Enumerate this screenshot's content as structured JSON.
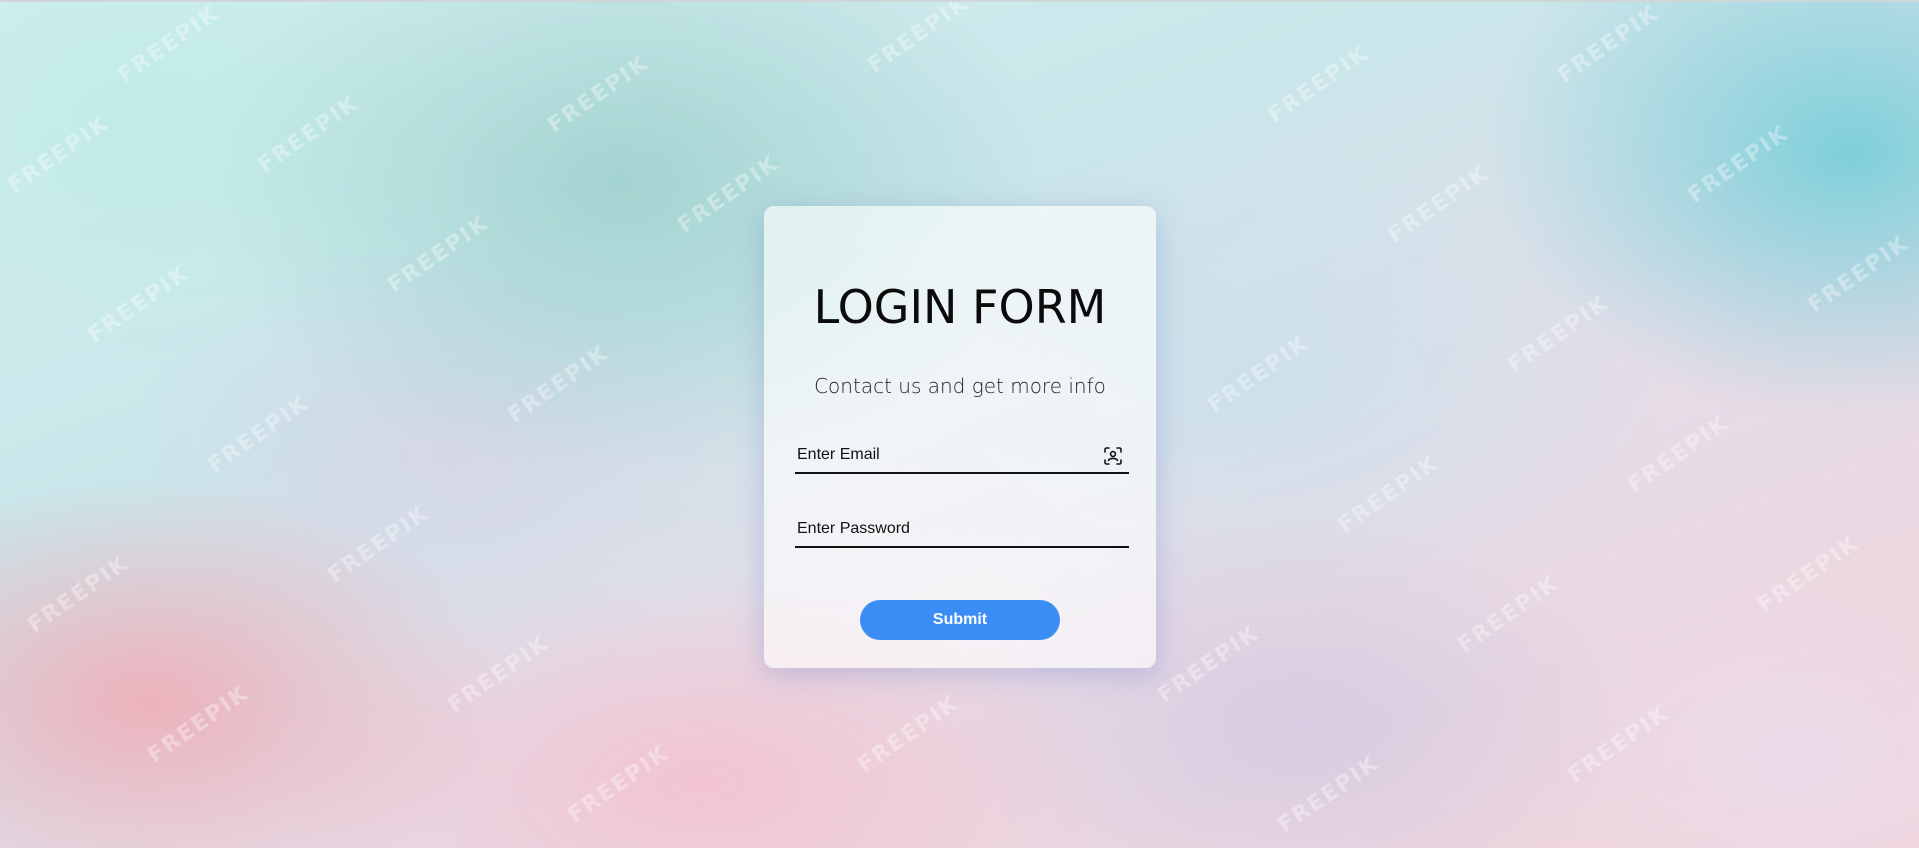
{
  "background": {
    "watermark_text": "FREEPIK"
  },
  "form": {
    "title": "LOGIN FORM",
    "subtitle": "Contact us and get more info",
    "email": {
      "placeholder": "Enter Email",
      "value": "",
      "icon": "scan-person-icon"
    },
    "password": {
      "placeholder": "Enter Password",
      "value": ""
    },
    "submit_label": "Submit"
  },
  "colors": {
    "accent": "#3a8df5",
    "text": "#0b0b0b"
  }
}
